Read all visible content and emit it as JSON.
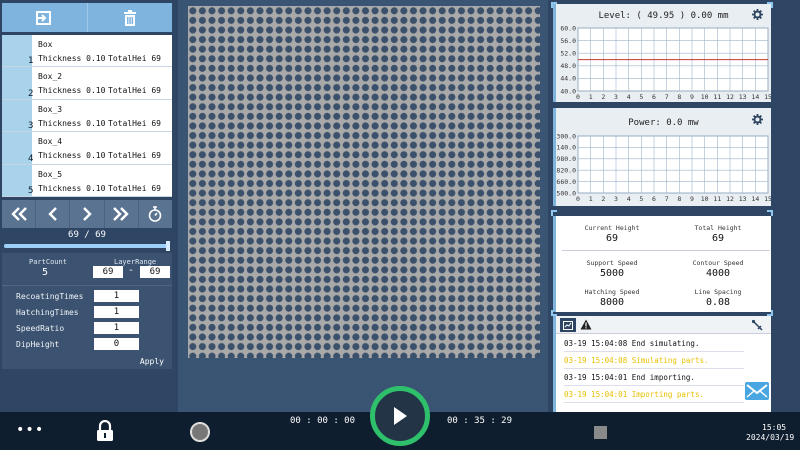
{
  "layer_list": {
    "items": [
      {
        "num": "1",
        "name": "Box",
        "thickness": "Thickness 0.10",
        "total": "TotalHei 69"
      },
      {
        "num": "2",
        "name": "Box_2",
        "thickness": "Thickness 0.10",
        "total": "TotalHei 69"
      },
      {
        "num": "3",
        "name": "Box_3",
        "thickness": "Thickness 0.10",
        "total": "TotalHei 69"
      },
      {
        "num": "4",
        "name": "Box_4",
        "thickness": "Thickness 0.10",
        "total": "TotalHei 69"
      },
      {
        "num": "5",
        "name": "Box_5",
        "thickness": "Thickness 0.10",
        "total": "TotalHei 69"
      }
    ]
  },
  "layer_nav": {
    "count": "69 / 69",
    "progress": 1.0
  },
  "params": {
    "part_count_label": "PartCount",
    "part_count": "5",
    "layer_range_label": "LayerRange",
    "layer_from": "69",
    "layer_dash": "-",
    "layer_to": "69",
    "recoating_label": "RecoatingTimes",
    "recoating": "1",
    "hatching_label": "HatchingTimes",
    "hatching": "1",
    "speed_ratio_label": "SpeedRatio",
    "speed_ratio": "1",
    "dip_label": "DipHeight",
    "dip": "0",
    "apply_label": "Apply"
  },
  "level_chart": {
    "title": "Level:  ( 49.95 )  0.00 mm",
    "y_ticks": [
      "60.0",
      "56.0",
      "52.0",
      "48.0",
      "44.0",
      "40.0"
    ],
    "x_ticks": [
      "0",
      "1",
      "2",
      "3",
      "4",
      "5",
      "6",
      "7",
      "8",
      "9",
      "10",
      "11",
      "12",
      "13",
      "14",
      "15"
    ]
  },
  "power_chart": {
    "title": "Power:  0.0 mw",
    "y_ticks": [
      "1300.0",
      "1140.0",
      "980.0",
      "820.0",
      "660.0",
      "500.0"
    ],
    "x_ticks": [
      "0",
      "1",
      "2",
      "3",
      "4",
      "5",
      "6",
      "7",
      "8",
      "9",
      "10",
      "11",
      "12",
      "13",
      "14",
      "15"
    ]
  },
  "chart_data": [
    {
      "type": "line",
      "title": "Level:  ( 49.95 )  0.00 mm",
      "x": [
        0,
        15
      ],
      "series": [
        {
          "values": [
            49.95,
            49.95
          ]
        }
      ],
      "xlim": [
        0,
        15
      ],
      "ylim": [
        40,
        60
      ],
      "grid": true
    },
    {
      "type": "line",
      "title": "Power:  0.0 mw",
      "x": [],
      "series": [],
      "xlim": [
        0,
        15
      ],
      "ylim": [
        500,
        1300
      ],
      "grid": true
    }
  ],
  "stats": {
    "current_height_label": "Current Height",
    "current_height": "69",
    "total_height_label": "Total Height",
    "total_height": "69",
    "support_speed_label": "Support Speed",
    "support_speed": "5000",
    "contour_speed_label": "Contour Speed",
    "contour_speed": "4000",
    "hatching_speed_label": "Hatching Speed",
    "hatching_speed": "8000",
    "line_spacing_label": "Line Spacing",
    "line_spacing": "0.08"
  },
  "log": {
    "rows": [
      {
        "text": "03-19 15:04:08  End simulating.",
        "color": "#111111"
      },
      {
        "text": "03-19 15:04:08  Simulating parts.",
        "color": "#e8c000"
      },
      {
        "text": "03-19 15:04:01  End importing.",
        "color": "#111111"
      },
      {
        "text": "03-19 15:04:01  Importing parts.",
        "color": "#e8c000"
      }
    ]
  },
  "bottombar": {
    "more_label": "•••",
    "elapsed": "00 : 00 : 00",
    "remaining": "00 : 35 : 29",
    "clock_time": "15:05",
    "clock_date": "2024/03/19"
  },
  "colors": {
    "accent": "#7fb4de",
    "play_ring": "#2ec06a",
    "warning_text": "#e8c000"
  }
}
